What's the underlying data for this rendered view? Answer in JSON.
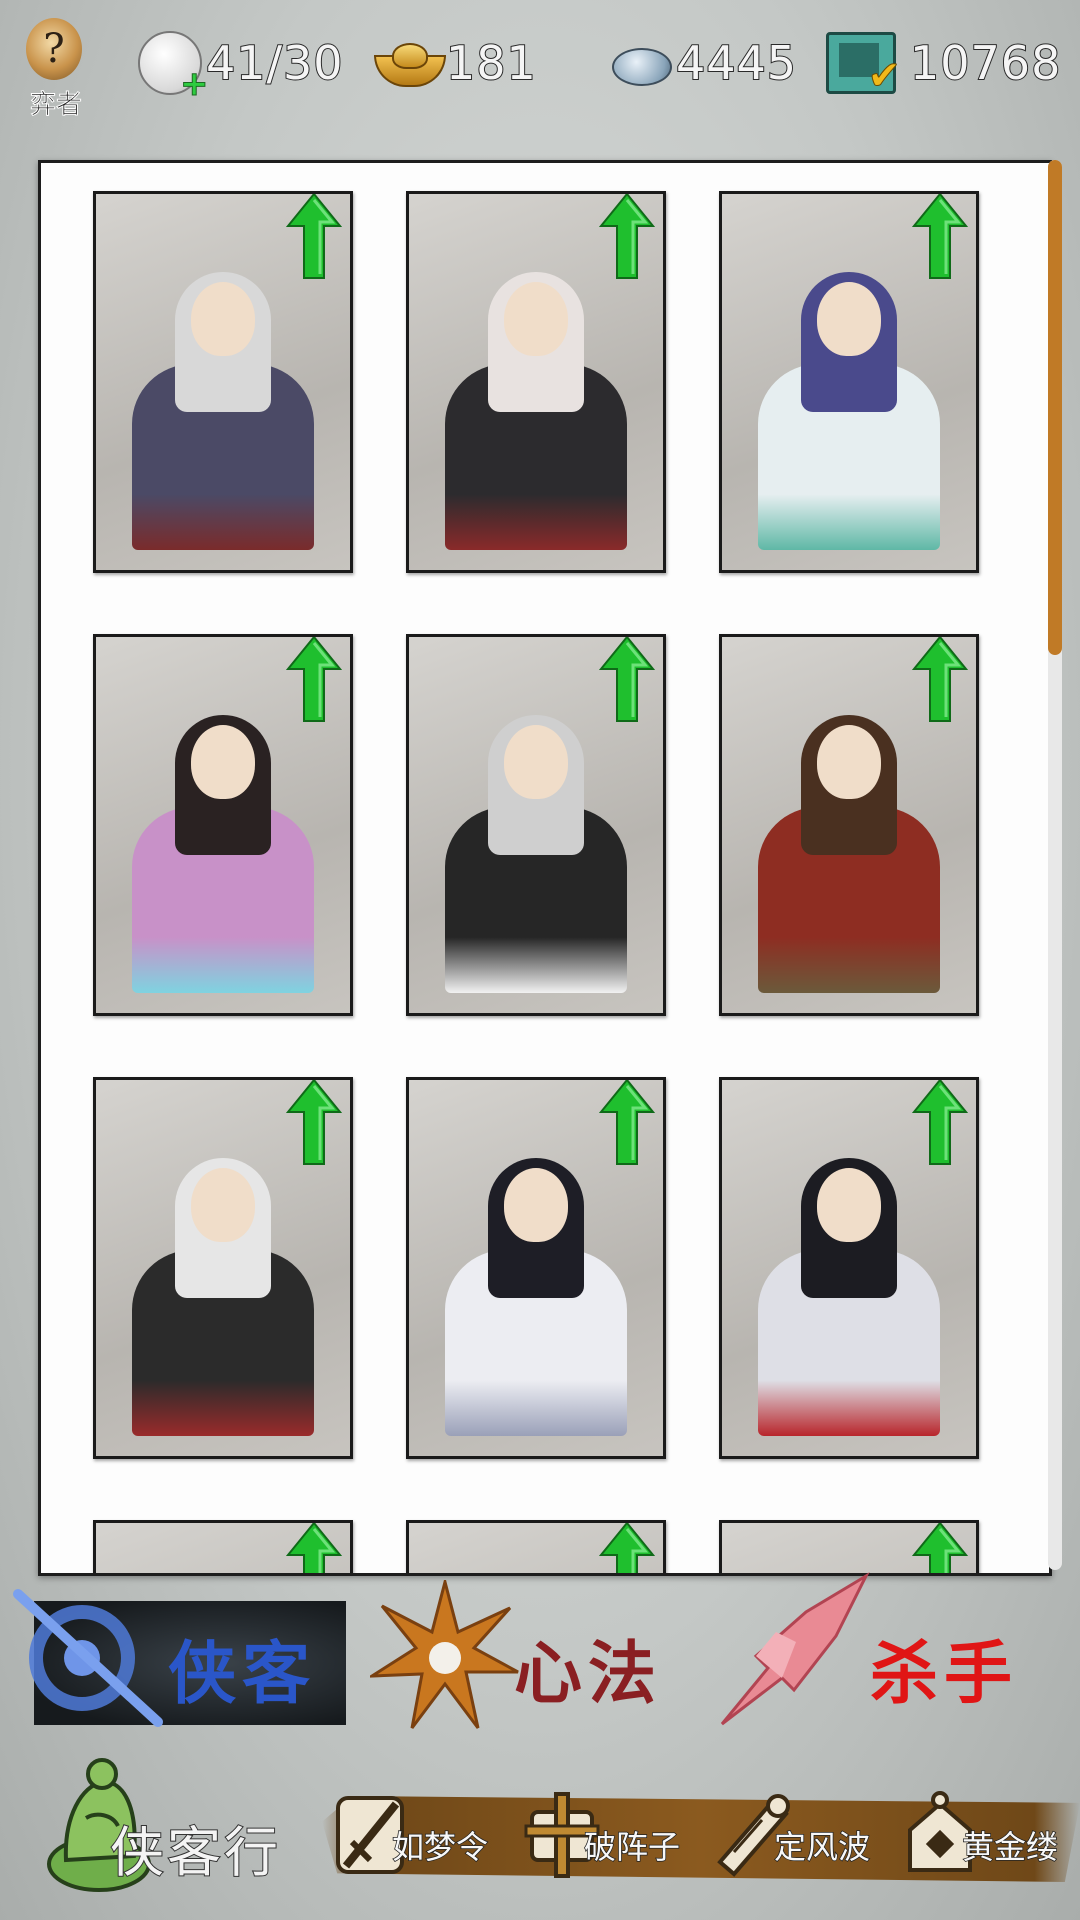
{
  "header": {
    "logo_text": "弈者",
    "stamina": "41/30",
    "gold": "181",
    "silver": "4445",
    "tickets": "10768"
  },
  "roster": {
    "cards": [
      {
        "name": "white-haired-warrior",
        "hair": "#d8d8d8",
        "robe": "#4b4a66",
        "accent": "#7a2b2b"
      },
      {
        "name": "red-scarf-blade",
        "hair": "#e8e2e0",
        "robe": "#2c2b2e",
        "accent": "#8a2a2a"
      },
      {
        "name": "blue-haired-dancer",
        "hair": "#4a4a8c",
        "robe": "#e6eef0",
        "accent": "#5fb8a6"
      },
      {
        "name": "parasol-lady",
        "hair": "#2a2222",
        "robe": "#c891c8",
        "accent": "#7fd3e0"
      },
      {
        "name": "panda-bun-girl",
        "hair": "#cfcfcf",
        "robe": "#262626",
        "accent": "#f2f2f2"
      },
      {
        "name": "rope-monk",
        "hair": "#4a3020",
        "robe": "#8e2d22",
        "accent": "#6b5a3b"
      },
      {
        "name": "fan-sage",
        "hair": "#e6e6e6",
        "robe": "#2b2b2b",
        "accent": "#9a2b2b"
      },
      {
        "name": "black-hair-swordsman",
        "hair": "#1e1e26",
        "robe": "#ecedf2",
        "accent": "#9aa0b8"
      },
      {
        "name": "red-ribbon-swordswoman",
        "hair": "#1c1c22",
        "robe": "#dedfe6",
        "accent": "#b8252b"
      },
      {
        "name": "partial-1",
        "hair": "#3a2a1c",
        "robe": "#8a7a60",
        "accent": "#000000"
      },
      {
        "name": "partial-2",
        "hair": "#2a2a22",
        "robe": "#555555",
        "accent": "#c9a23a"
      },
      {
        "name": "partial-3",
        "hair": "#222222",
        "robe": "#666666",
        "accent": "#000000"
      }
    ]
  },
  "tabs": [
    {
      "label": "侠客",
      "color": "#2a56c9"
    },
    {
      "label": "心法",
      "color": "#8a1f22"
    },
    {
      "label": "杀手",
      "color": "#e01515"
    }
  ],
  "bottom": {
    "main_label": "侠客行",
    "items": [
      {
        "label": "如梦令",
        "icon": "sword-icon"
      },
      {
        "label": "破阵子",
        "icon": "banner-icon"
      },
      {
        "label": "定风波",
        "icon": "scroll-icon"
      },
      {
        "label": "黄金缕",
        "icon": "treasure-icon"
      }
    ]
  },
  "colors": {
    "upgrade_arrow": "#1fbf2e",
    "scroll_thumb": "#c07a26",
    "banner": "#8b5a1f"
  }
}
